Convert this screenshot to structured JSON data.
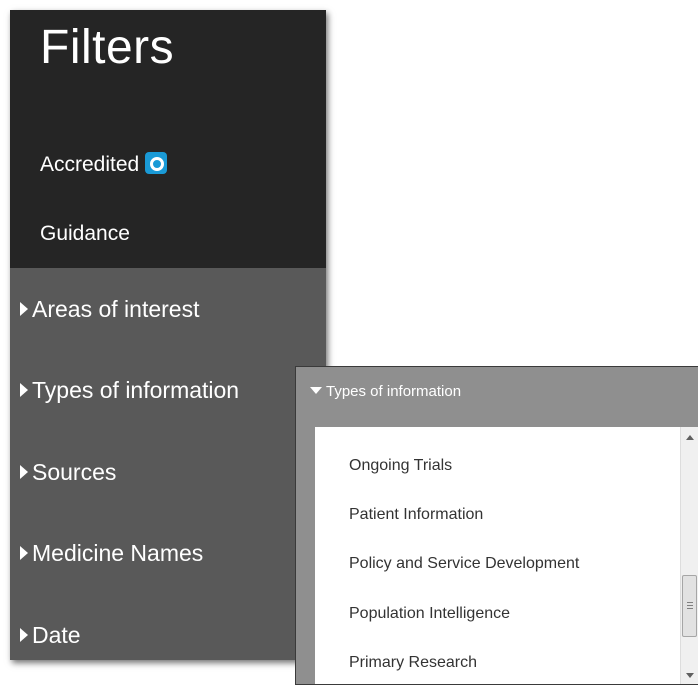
{
  "sidebar": {
    "title": "Filters",
    "top_items": [
      {
        "label": "Accredited",
        "badge_icon": "accredited-badge-icon"
      },
      {
        "label": "Guidance"
      }
    ],
    "facets": [
      {
        "label": "Areas of interest",
        "expanded": false
      },
      {
        "label": "Types of information",
        "expanded": false
      },
      {
        "label": "Sources",
        "expanded": false
      },
      {
        "label": "Medicine Names",
        "expanded": false
      },
      {
        "label": "Date",
        "expanded": false
      }
    ]
  },
  "popup": {
    "header": "Types of information",
    "items": [
      "Ongoing Trials",
      "Patient Information",
      "Policy and Service Development",
      "Population Intelligence",
      "Primary Research"
    ]
  },
  "colors": {
    "sidebar_top": "#252525",
    "sidebar_facets": "#595959",
    "popup_frame": "#8f8f8f",
    "badge_blue": "#1a9ad6"
  }
}
